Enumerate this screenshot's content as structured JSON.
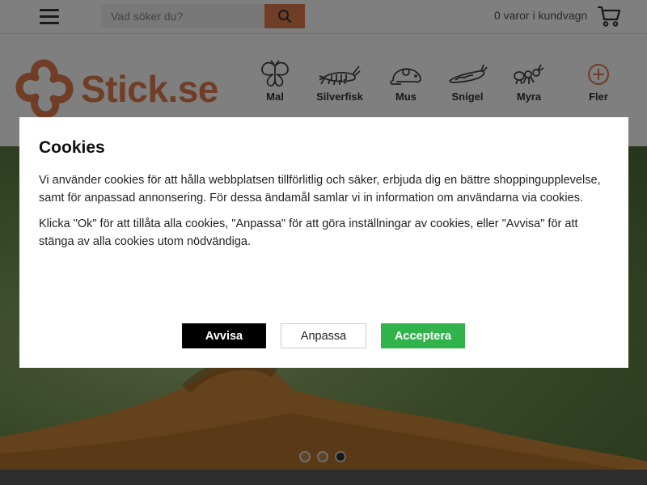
{
  "topbar": {
    "search_placeholder": "Vad söker du?",
    "cart_text": "0 varor i kundvagn"
  },
  "header": {
    "logo_text": "Stick.se",
    "nav": [
      {
        "label": "Mal",
        "icon": "moth-icon"
      },
      {
        "label": "Silverfisk",
        "icon": "silverfish-icon"
      },
      {
        "label": "Mus",
        "icon": "mouse-icon"
      },
      {
        "label": "Snigel",
        "icon": "slug-icon"
      },
      {
        "label": "Myra",
        "icon": "ant-icon"
      },
      {
        "label": "Fler",
        "icon": "plus-circle-icon"
      }
    ]
  },
  "carousel": {
    "slides": 3,
    "active_index": 2
  },
  "cookie_dialog": {
    "title": "Cookies",
    "paragraph1": "Vi använder cookies för att hålla webbplatsen tillförlitlig och säker, erbjuda dig en bättre shoppingupplevelse, samt för anpassad annonsering. För dessa ändamål samlar vi in information om användarna via cookies.",
    "paragraph2": "Klicka \"Ok\" för att tillåta alla cookies, \"Anpassa\" för att göra inställningar av cookies, eller \"Avvisa\" för att stänga av alla cookies utom nödvändiga.",
    "reject_label": "Avvisa",
    "customize_label": "Anpassa",
    "accept_label": "Acceptera"
  },
  "colors": {
    "brand": "#e07a4f",
    "accept": "#2fb34a",
    "reject": "#000000"
  }
}
